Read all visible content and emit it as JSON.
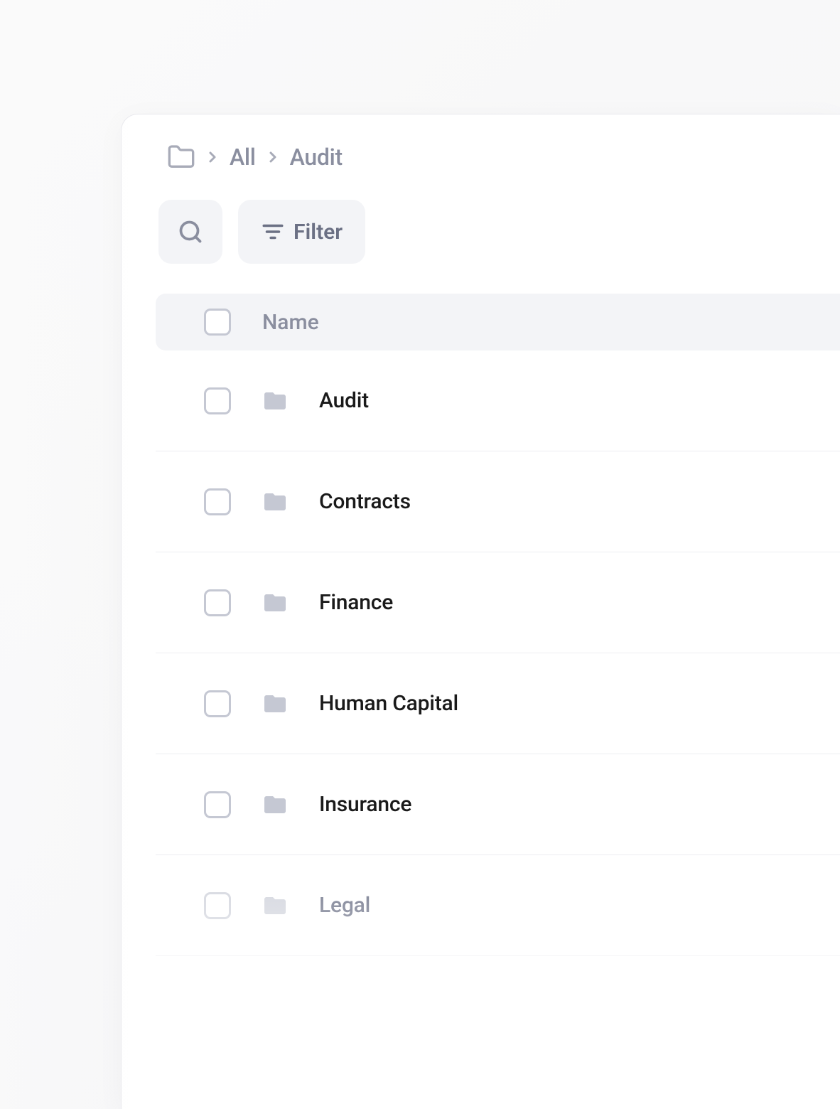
{
  "breadcrumb": {
    "root": "All",
    "current": "Audit"
  },
  "toolbar": {
    "filter_label": "Filter"
  },
  "table": {
    "header_name": "Name"
  },
  "folders": [
    {
      "name": "Audit"
    },
    {
      "name": "Contracts"
    },
    {
      "name": "Finance"
    },
    {
      "name": "Human Capital"
    },
    {
      "name": "Insurance"
    },
    {
      "name": "Legal"
    }
  ]
}
